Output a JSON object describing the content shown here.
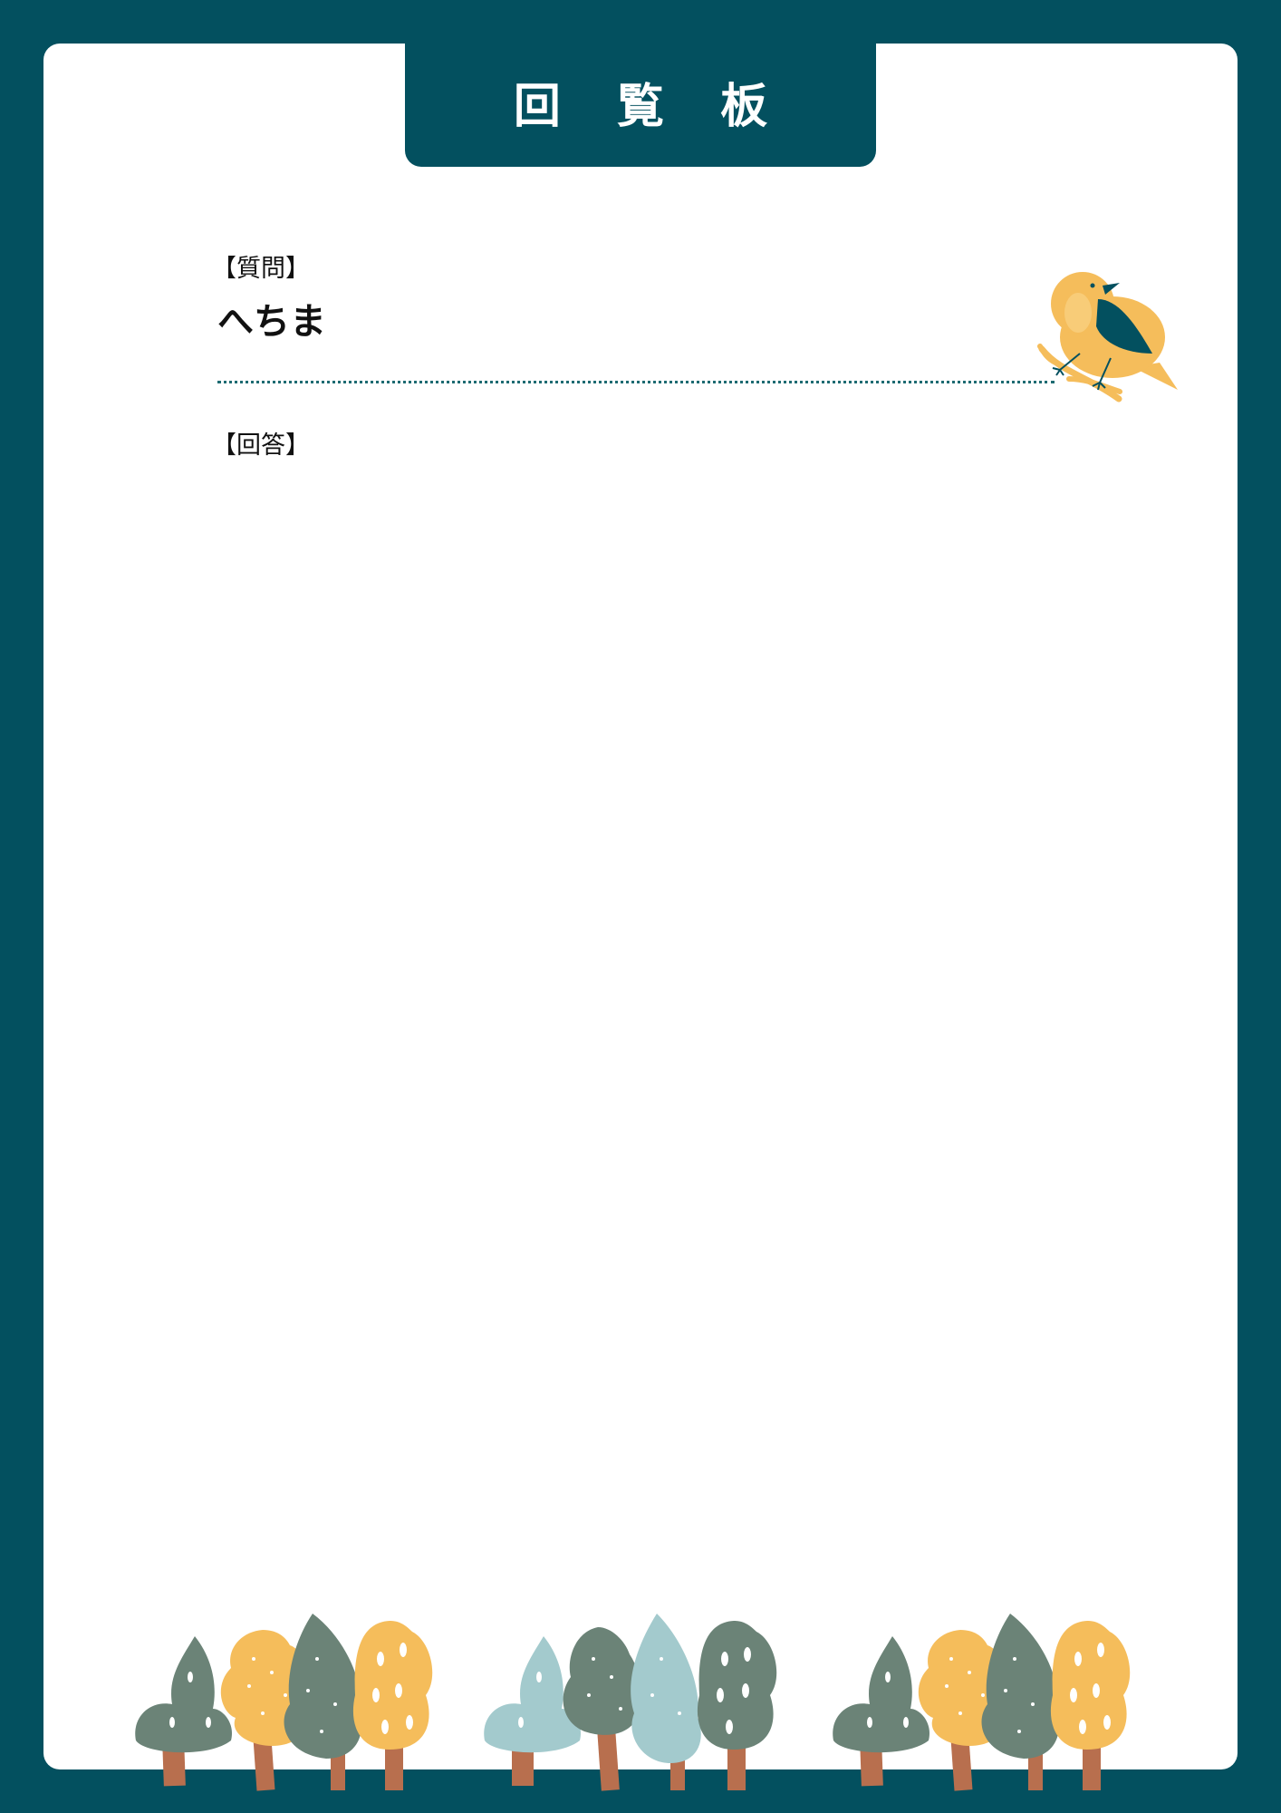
{
  "header": {
    "title": "回 覧 板"
  },
  "question": {
    "label": "【質問】",
    "text": "へちま"
  },
  "answer": {
    "label": "【回答】"
  },
  "illustrations": {
    "bird": "bird-on-branch",
    "trees": "forest-trees"
  },
  "colors": {
    "frame": "#03505f",
    "mustard": "#f5bd5b",
    "dark_green": "#6b8377",
    "pale_blue": "#a3cacd",
    "trunk": "#b86f4e"
  }
}
